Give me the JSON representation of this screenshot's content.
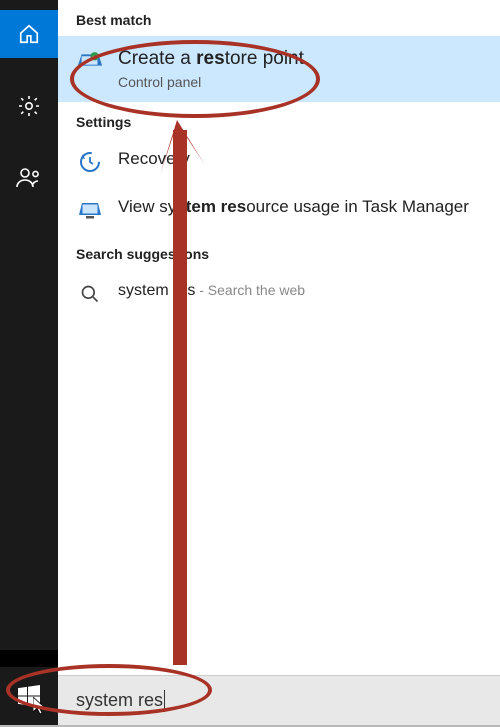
{
  "sidebar": {
    "items": [
      {
        "name": "home-icon"
      },
      {
        "name": "gear-icon"
      },
      {
        "name": "people-icon"
      }
    ]
  },
  "sections": {
    "best_match_header": "Best match",
    "settings_header": "Settings",
    "suggestions_header": "Search suggestions"
  },
  "best_match": {
    "title_pre": "Create a ",
    "title_bold": "res",
    "title_post": "tore point",
    "sub": "Control panel"
  },
  "settings_items": [
    {
      "title_pre": "",
      "title_bold": "",
      "title_post": "Recovery",
      "sub": ""
    },
    {
      "title_pre": "View sy",
      "title_bold": "stem res",
      "title_post": "ource usage in Task Manager",
      "sub": ""
    }
  ],
  "suggestion": {
    "text_pre": "system",
    "text_post": " res",
    "suffix": " - Search the web"
  },
  "search": {
    "value": "system res"
  }
}
